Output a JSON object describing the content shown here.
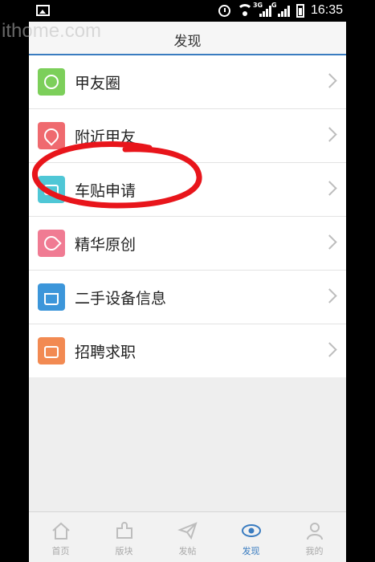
{
  "status_bar": {
    "time": "16:35",
    "network_tag_1": "3G",
    "network_tag_2": "G"
  },
  "watermark": "ithome.com",
  "header": {
    "title": "发现"
  },
  "menu": [
    {
      "label": "甲友圈",
      "icon": "chat-bubble-icon",
      "color": "#7ccf5a"
    },
    {
      "label": "附近甲友",
      "icon": "location-pin-icon",
      "color": "#ef6a6f"
    },
    {
      "label": "车贴申请",
      "icon": "card-icon",
      "color": "#4fc7d6"
    },
    {
      "label": "精华原创",
      "icon": "pen-nib-icon",
      "color": "#f07b93"
    },
    {
      "label": "二手设备信息",
      "icon": "shopping-bag-icon",
      "color": "#3c96da"
    },
    {
      "label": "招聘求职",
      "icon": "briefcase-icon",
      "color": "#f28a52"
    }
  ],
  "tabs": [
    {
      "label": "首页",
      "icon": "home-icon",
      "active": false
    },
    {
      "label": "版块",
      "icon": "puzzle-icon",
      "active": false
    },
    {
      "label": "发帖",
      "icon": "send-icon",
      "active": false
    },
    {
      "label": "发现",
      "icon": "eye-icon",
      "active": true
    },
    {
      "label": "我的",
      "icon": "user-icon",
      "active": false
    }
  ],
  "accent_color": "#3a7cc0"
}
